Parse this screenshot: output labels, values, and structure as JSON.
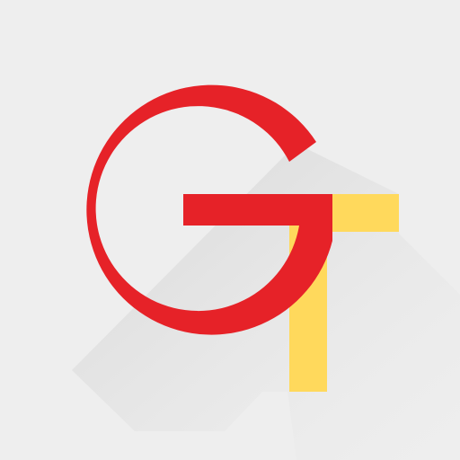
{
  "logo": {
    "letters": [
      "G",
      "T"
    ],
    "colors": {
      "background": "#ffffff",
      "tile": "#eeeeee",
      "shadow": "#d2d2d2",
      "g_letter": "#e62228",
      "t_letter": "#ffd95c"
    }
  }
}
